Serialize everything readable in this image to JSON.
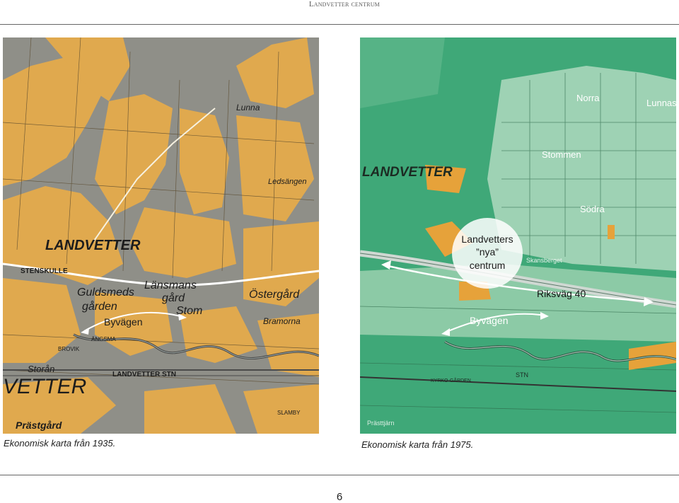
{
  "header": {
    "title": "Landvetter centrum"
  },
  "left_map": {
    "caption": "Ekonomisk karta från 1935.",
    "labels": {
      "landvetter": "LANDVETTER",
      "stenskulle": "STENSKULLE",
      "guldsmeds": "Guldsmeds",
      "garden": "gården",
      "lansmans": "Länsmans",
      "gard": "gård",
      "stom": "Stom",
      "ostergard": "Östergård",
      "bramorna": "Bramorna",
      "byvagen": "Byvägen",
      "ledsangen": "Ledsängen",
      "lunna": "Lunna",
      "storan": "Storån",
      "vetter": "VETTER",
      "prastgard": "Prästgård",
      "landvetter_stn": "LANDVETTER STN",
      "brovik": "BROVIK",
      "slamby": "SLAMBY",
      "angsma": "ÄNGSMA"
    }
  },
  "right_map": {
    "caption": "Ekonomisk karta från 1975.",
    "labels": {
      "landvetter": "LANDVETTER",
      "norra": "Norra",
      "lunnas": "Lunnas",
      "stommen": "Stommen",
      "sodra": "Södra",
      "nya_line1": "Landvetters",
      "nya_line2": "”nya”",
      "nya_line3": "centrum",
      "skansberget": "Skansberget",
      "riksvag": "Riksväg 40",
      "byvagen": "Byvägen",
      "prasttjarn": "Prästtjärn",
      "stn": "STN",
      "kyrkogarden": "KYRKO-GÅRDEN"
    }
  },
  "page_number": "6",
  "colors": {
    "old_map_field": "#e0a94e",
    "old_map_gray": "#8f8f88",
    "new_map_green": "#3fa878",
    "new_map_light": "#9ed2b4",
    "new_map_orange": "#e6a23a"
  }
}
